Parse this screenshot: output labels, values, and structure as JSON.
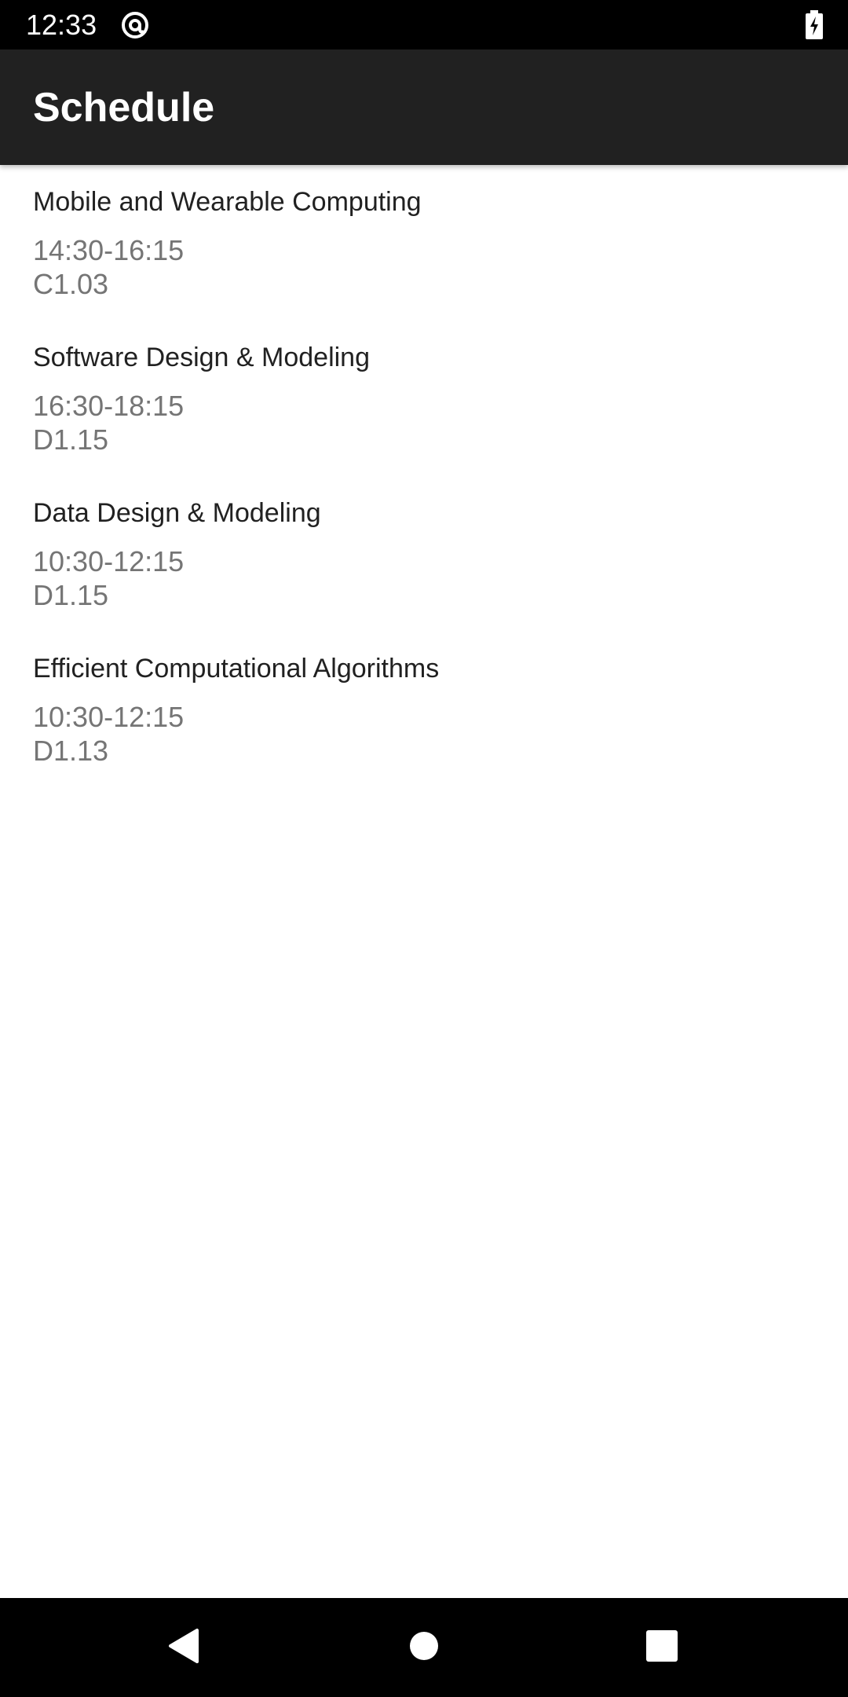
{
  "status_bar": {
    "time": "12:33",
    "app_icon": "at-sign-icon",
    "battery_icon": "battery-charging-icon"
  },
  "app_bar": {
    "title": "Schedule",
    "background": "#212121"
  },
  "schedule": [
    {
      "course": "Mobile and Wearable Computing",
      "time": "14:30-16:15",
      "room": "C1.03"
    },
    {
      "course": "Software Design & Modeling",
      "time": "16:30-18:15",
      "room": "D1.15"
    },
    {
      "course": "Data Design & Modeling",
      "time": "10:30-12:15",
      "room": "D1.15"
    },
    {
      "course": "Efficient Computational Algorithms",
      "time": "10:30-12:15",
      "room": "D1.13"
    }
  ],
  "nav_bar": {
    "back_icon": "back-triangle-icon",
    "home_icon": "home-circle-icon",
    "recents_icon": "recents-square-icon"
  },
  "colors": {
    "title_text": "#212121",
    "secondary_text": "#757575"
  }
}
